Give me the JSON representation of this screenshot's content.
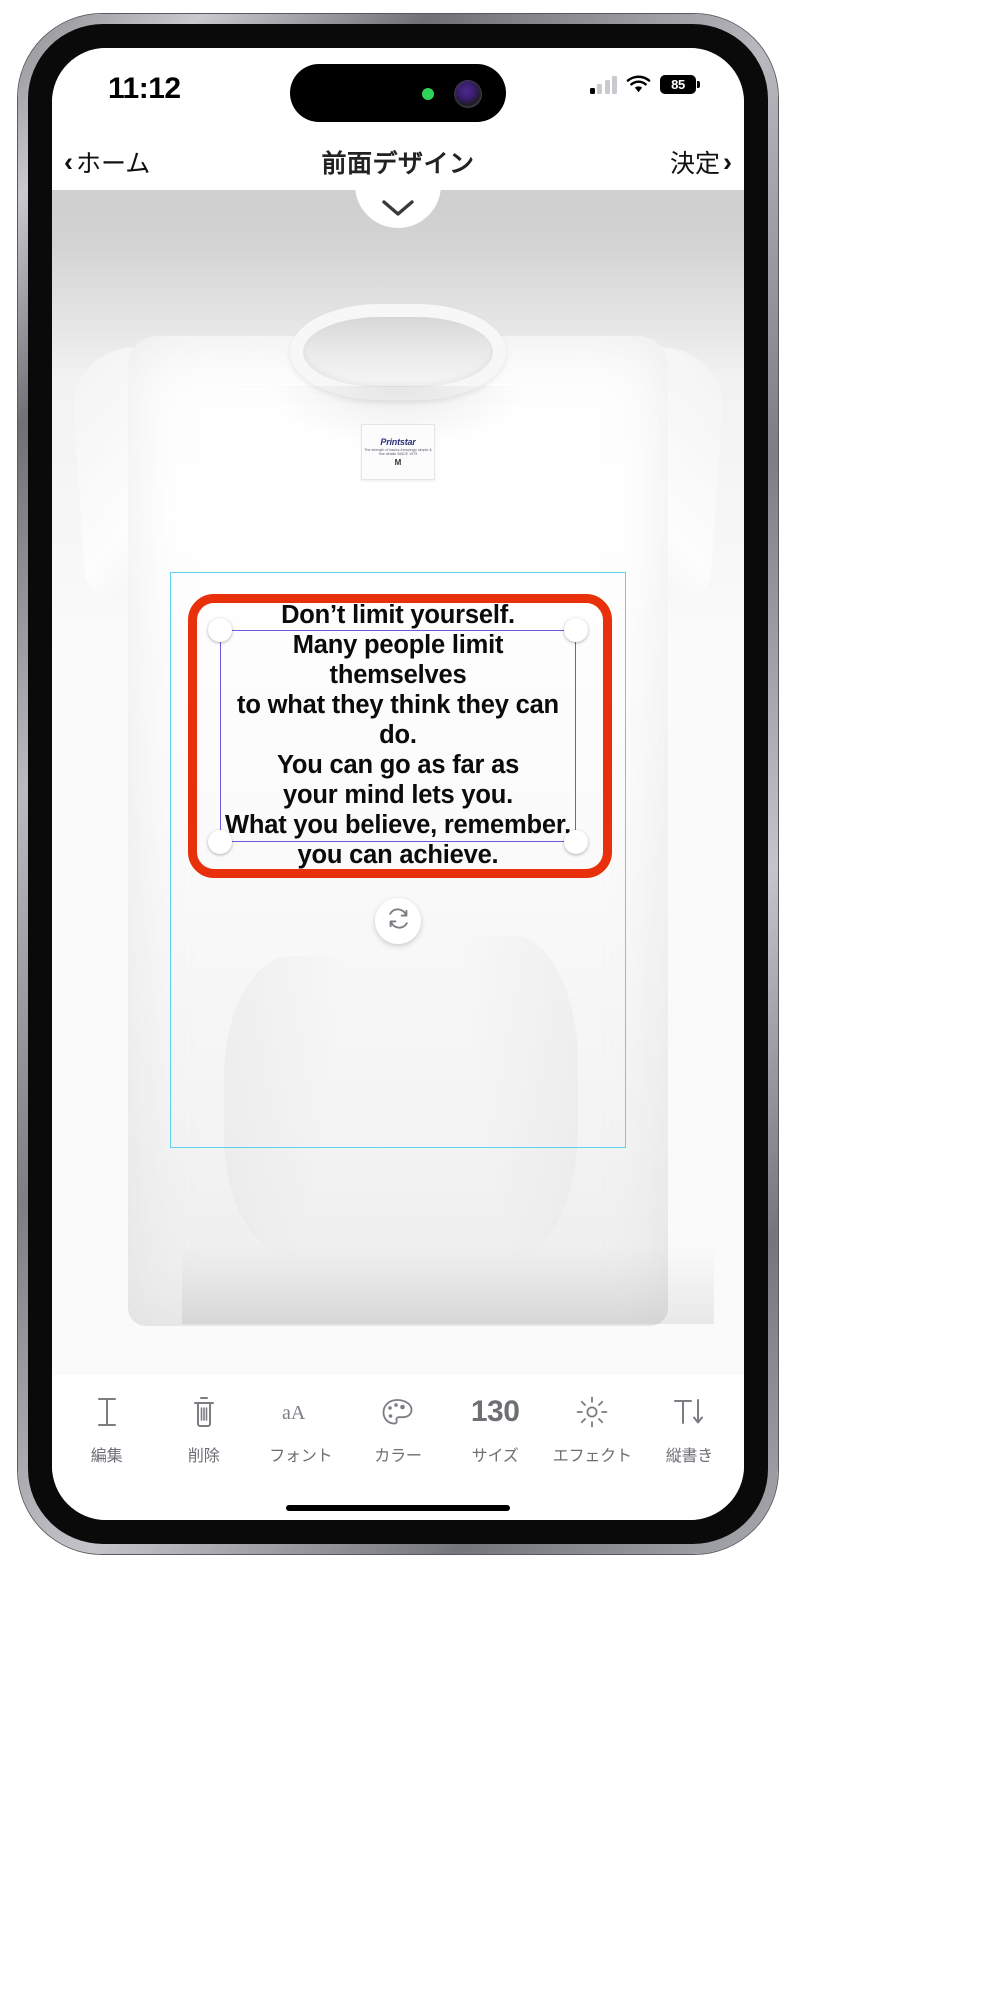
{
  "status_bar": {
    "time": "11:12",
    "battery_level": "85",
    "signal_icon": "cellular-signal-icon",
    "wifi_icon": "wifi-icon",
    "battery_icon": "battery-icon",
    "dynamic_island_green_dot": "camera-active-indicator",
    "dynamic_island_camera": "front-camera-lens"
  },
  "nav_bar": {
    "back_chevron": "‹",
    "back_label": "ホーム",
    "title": "前面デザイン",
    "done_label": "決定",
    "done_chevron": "›"
  },
  "canvas": {
    "collapse_icon": "chevron-down-icon",
    "product": {
      "brand_name": "Printstar",
      "brand_sub": "The strength of basics\nAmazingly simple & fine details\nSINCE 1979",
      "size_label": "M"
    },
    "rotate_icon": "rotate-refresh-icon",
    "selection_color": "#e8300b",
    "boundary_color": "#5ed3e8",
    "textbox_color": "#6a5ae0",
    "design_text": "Don’t limit yourself.\nMany people limit themselves\nto what they think they can do.\nYou can go as far as\nyour mind lets you.\nWhat you believe, remember,\nyou can achieve."
  },
  "toolbar": {
    "items": [
      {
        "label": "編集",
        "icon": "text-cursor-icon",
        "value": ""
      },
      {
        "label": "削除",
        "icon": "trash-icon",
        "value": ""
      },
      {
        "label": "フォント",
        "icon": "font-aA-icon",
        "value": ""
      },
      {
        "label": "カラー",
        "icon": "color-palette-icon",
        "value": ""
      },
      {
        "label": "サイズ",
        "icon": "size-number-icon",
        "value": "130"
      },
      {
        "label": "エフェクト",
        "icon": "effect-sparkle-icon",
        "value": ""
      },
      {
        "label": "縦書き",
        "icon": "vertical-text-icon",
        "value": ""
      }
    ]
  }
}
